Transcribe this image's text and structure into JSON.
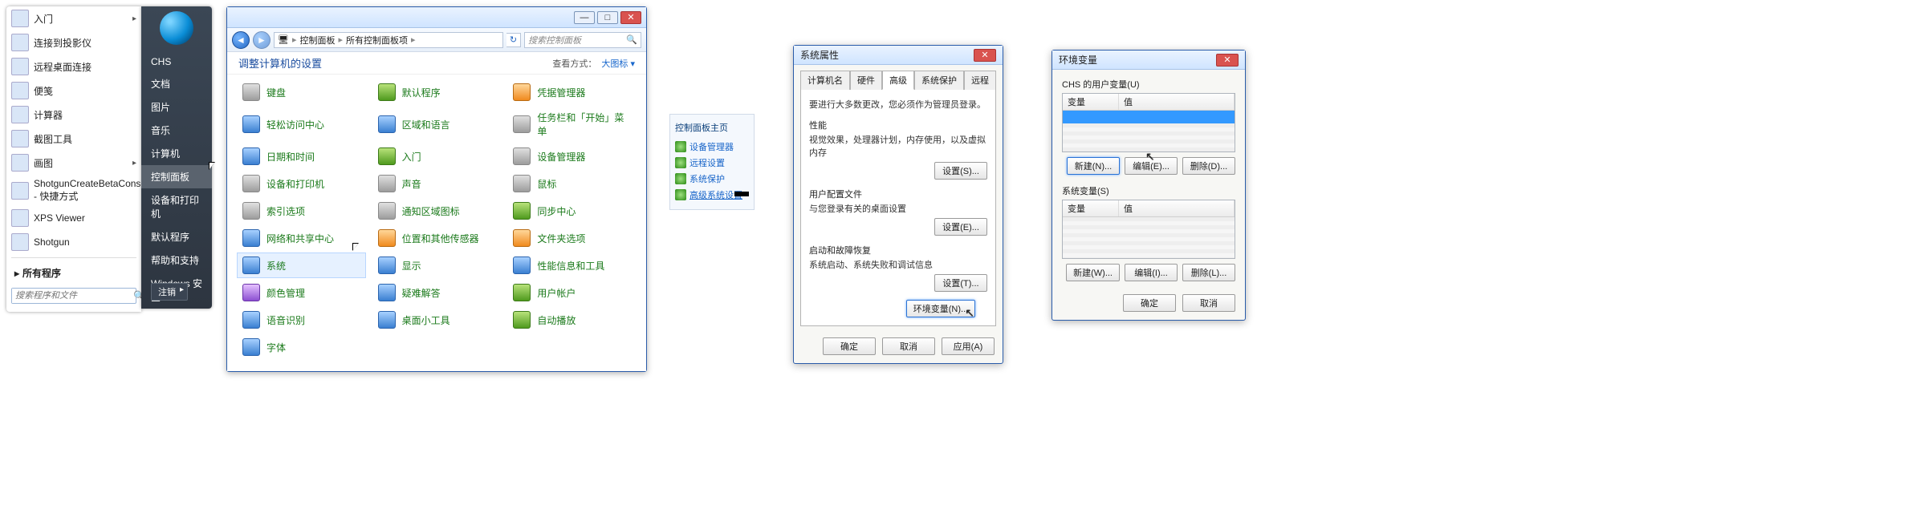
{
  "startmenu": {
    "left_items": [
      {
        "label": "入门",
        "arrow": true
      },
      {
        "label": "连接到投影仪"
      },
      {
        "label": "远程桌面连接"
      },
      {
        "label": "便笺"
      },
      {
        "label": "计算器"
      },
      {
        "label": "截图工具"
      },
      {
        "label": "画图",
        "arrow": true
      },
      {
        "label": "ShotgunCreateBetaConsole - 快捷方式"
      },
      {
        "label": "XPS Viewer"
      },
      {
        "label": "Shotgun"
      }
    ],
    "all_programs": "所有程序",
    "search_placeholder": "搜索程序和文件",
    "right_items": [
      "CHS",
      "文档",
      "图片",
      "音乐",
      "计算机",
      "控制面板",
      "设备和打印机",
      "默认程序",
      "帮助和支持",
      "Windows 安全"
    ],
    "right_selected_index": 5,
    "shutdown": "注销"
  },
  "cp": {
    "breadcrumb": [
      "控制面板",
      "所有控制面板项"
    ],
    "search_placeholder": "搜索控制面板",
    "heading": "调整计算机的设置",
    "viewby_label": "查看方式：",
    "viewby_value": "大图标",
    "items": [
      {
        "label": "键盘",
        "c": "grey"
      },
      {
        "label": "默认程序",
        "c": "green"
      },
      {
        "label": "凭据管理器",
        "c": "orange"
      },
      {
        "label": "轻松访问中心",
        "c": "blue"
      },
      {
        "label": "区域和语言",
        "c": "blue"
      },
      {
        "label": "任务栏和「开始」菜单",
        "c": "grey"
      },
      {
        "label": "日期和时间",
        "c": "blue"
      },
      {
        "label": "入门",
        "c": "green"
      },
      {
        "label": "设备管理器",
        "c": "grey"
      },
      {
        "label": "设备和打印机",
        "c": "grey"
      },
      {
        "label": "声音",
        "c": "grey"
      },
      {
        "label": "鼠标",
        "c": "grey"
      },
      {
        "label": "索引选项",
        "c": "grey"
      },
      {
        "label": "通知区域图标",
        "c": "grey"
      },
      {
        "label": "同步中心",
        "c": "green"
      },
      {
        "label": "网络和共享中心",
        "c": "blue"
      },
      {
        "label": "位置和其他传感器",
        "c": "orange"
      },
      {
        "label": "文件夹选项",
        "c": "orange"
      },
      {
        "label": "系统",
        "c": "blue",
        "selected": true
      },
      {
        "label": "显示",
        "c": "blue"
      },
      {
        "label": "性能信息和工具",
        "c": "blue"
      },
      {
        "label": "颜色管理",
        "c": "purple"
      },
      {
        "label": "疑难解答",
        "c": "blue"
      },
      {
        "label": "用户帐户",
        "c": "green"
      },
      {
        "label": "语音识别",
        "c": "blue"
      },
      {
        "label": "桌面小工具",
        "c": "blue"
      },
      {
        "label": "自动播放",
        "c": "green"
      },
      {
        "label": "字体",
        "c": "blue"
      }
    ]
  },
  "cpside": {
    "title": "控制面板主页",
    "items": [
      "设备管理器",
      "远程设置",
      "系统保护",
      "高级系统设置"
    ],
    "selected_index": 3
  },
  "sysprop": {
    "title": "系统属性",
    "tabs": [
      "计算机名",
      "硬件",
      "高级",
      "系统保护",
      "远程"
    ],
    "active_tab": 2,
    "notice": "要进行大多数更改，您必须作为管理员登录。",
    "sections": [
      {
        "title": "性能",
        "desc": "视觉效果，处理器计划，内存使用，以及虚拟内存",
        "btn": "设置(S)..."
      },
      {
        "title": "用户配置文件",
        "desc": "与您登录有关的桌面设置",
        "btn": "设置(E)..."
      },
      {
        "title": "启动和故障恢复",
        "desc": "系统启动、系统失败和调试信息",
        "btn": "设置(T)..."
      }
    ],
    "env_btn": "环境变量(N)...",
    "ok": "确定",
    "cancel": "取消",
    "apply": "应用(A)"
  },
  "env": {
    "title": "环境变量",
    "user_label": "CHS 的用户变量(U)",
    "cols": {
      "var": "变量",
      "val": "值"
    },
    "sys_label": "系统变量(S)",
    "new": "新建(N)...",
    "edit": "编辑(E)...",
    "del": "删除(D)...",
    "new2": "新建(W)...",
    "edit2": "编辑(I)...",
    "del2": "删除(L)...",
    "ok": "确定",
    "cancel": "取消"
  }
}
